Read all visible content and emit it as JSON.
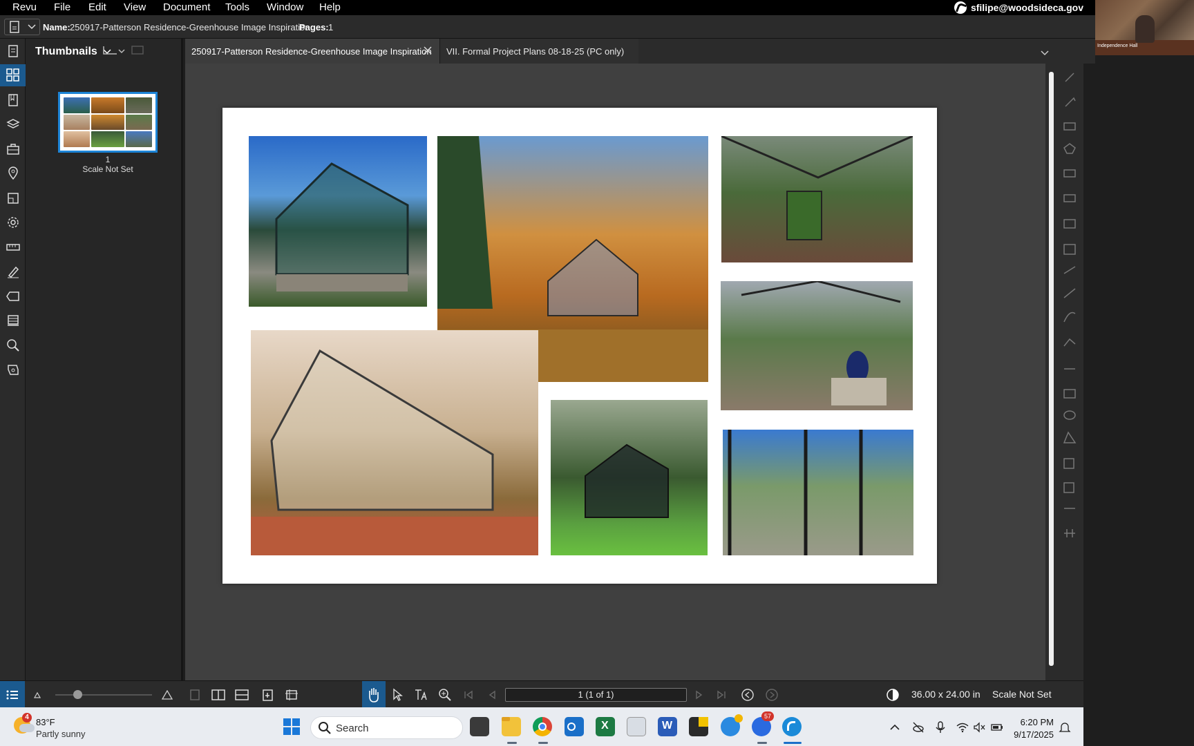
{
  "menu": {
    "items": [
      "Revu",
      "File",
      "Edit",
      "View",
      "Document",
      "Tools",
      "Window",
      "Help"
    ],
    "account": "sfilipe@woodsideca.gov"
  },
  "webcam": {
    "label": "Independence Hall"
  },
  "docinfo": {
    "name_label": "Name:",
    "name_value": "250917-Patterson Residence-Greenhouse Image Inspiration",
    "pages_label": "Pages:",
    "pages_value": "1"
  },
  "thumbnails": {
    "title": "Thumbnails",
    "page_number": "1",
    "scale": "Scale Not Set"
  },
  "tabs": [
    {
      "label": "250917-Patterson Residence-Greenhouse Image Inspiration",
      "active": true
    },
    {
      "label": "VII. Formal Project Plans 08-18-25 (PC only)",
      "active": false
    }
  ],
  "status": {
    "page_field": "1 (1 of 1)",
    "page_size": "36.00 x 24.00 in",
    "scale": "Scale Not Set"
  },
  "taskbar": {
    "weather_temp": "83°F",
    "weather_desc": "Partly sunny",
    "weather_badge": "4",
    "search_label": "Search",
    "time": "6:20 PM",
    "date": "9/17/2025",
    "mail_badge": "57"
  },
  "colors": {
    "accent": "#1b5a8f",
    "thumb_border": "#1d84d6",
    "canvas": "#404040"
  }
}
